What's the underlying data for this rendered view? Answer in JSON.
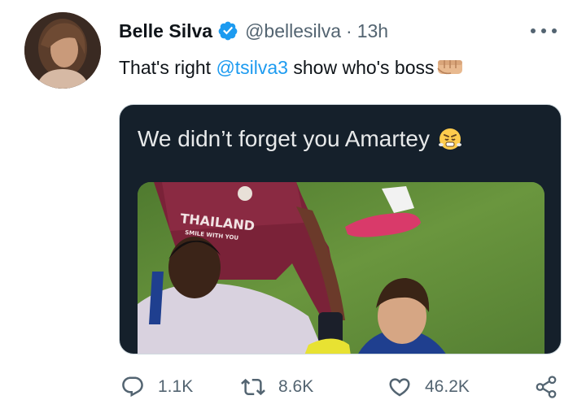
{
  "author": {
    "name": "Belle Silva",
    "handle": "@bellesilva",
    "separator": "·",
    "time": "13h",
    "verified": true
  },
  "tweet": {
    "text_before": "That's right ",
    "mention": "@tsilva3",
    "text_after": " show who's boss",
    "trailing_emoji": "fist-emoji"
  },
  "media": {
    "caption": "We didn’t forget you Amartey",
    "caption_emoji": "huffing-face-emoji",
    "jersey_text_1": "THAILAND",
    "jersey_text_2": "SMILE WITH YOU"
  },
  "actions": {
    "replies": "1.1K",
    "retweets": "8.6K",
    "likes": "46.2K"
  },
  "colors": {
    "accent": "#1d9bf0",
    "secondary_text": "#536471",
    "media_bg": "#15202b"
  }
}
